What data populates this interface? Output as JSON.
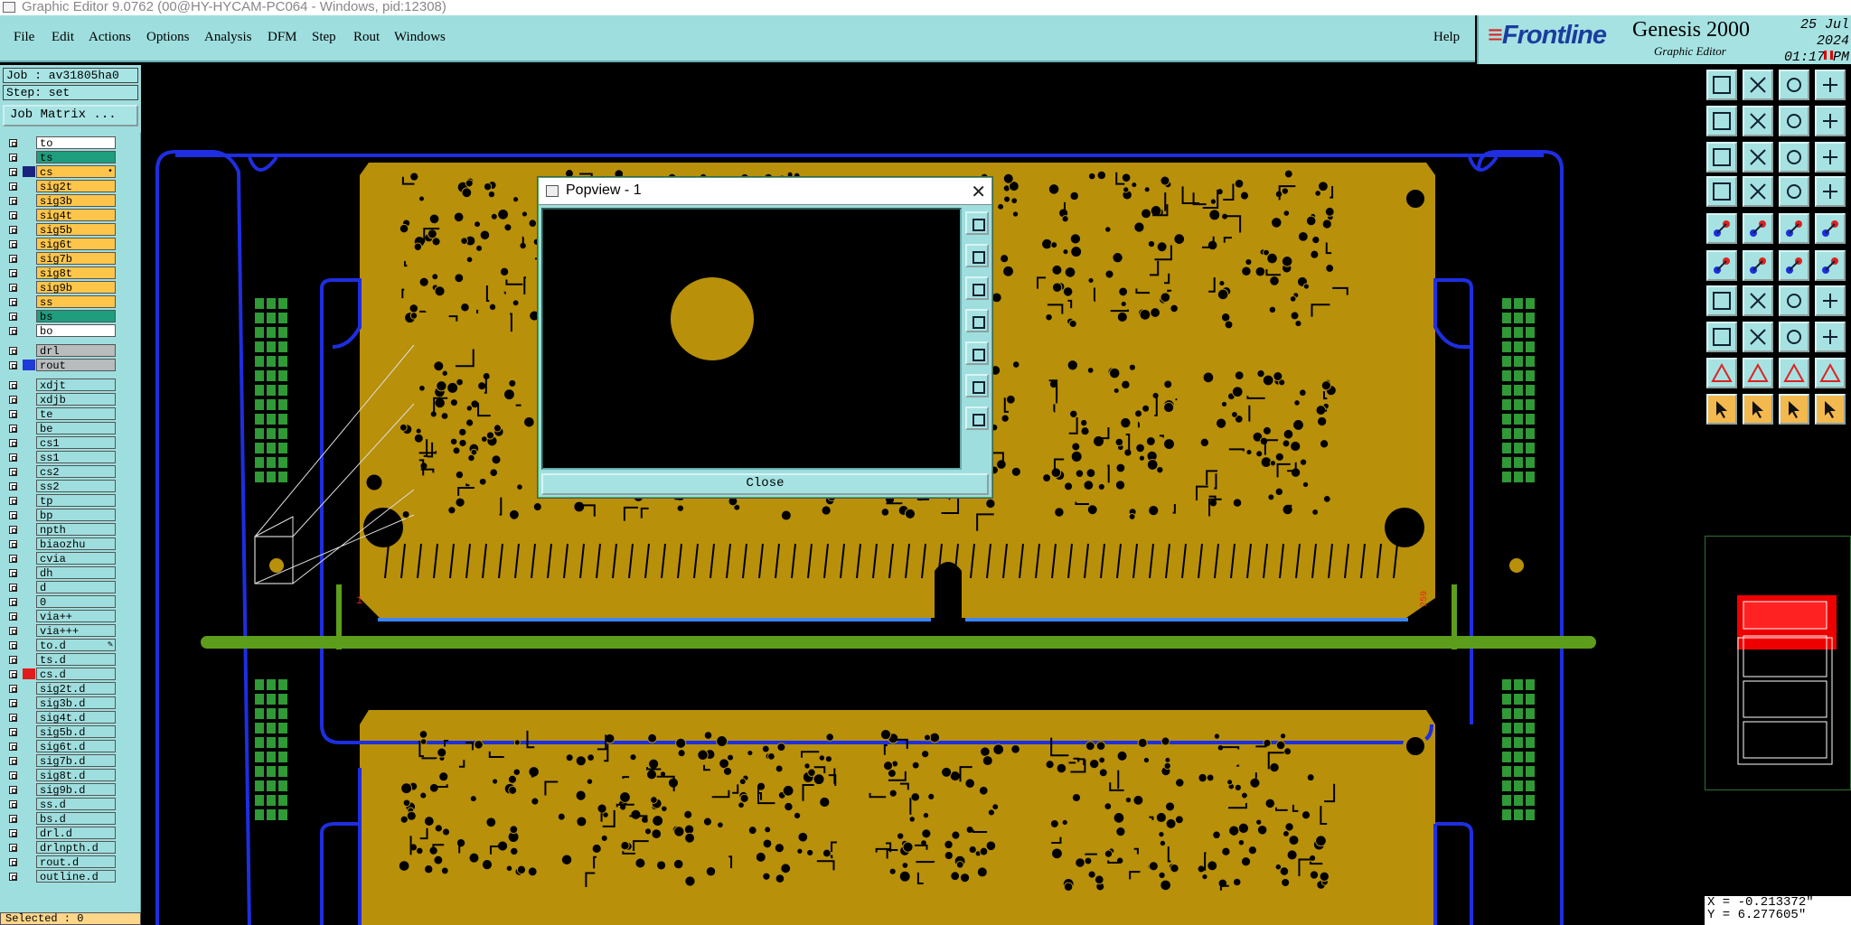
{
  "window": {
    "title": "Graphic Editor 9.0762 (00@HY-HYCAM-PC064 - Windows, pid:12308)"
  },
  "menu": {
    "items": [
      "File",
      "Edit",
      "Actions",
      "Options",
      "Analysis",
      "DFM",
      "Step",
      "Rout",
      "Windows"
    ],
    "help": "Help"
  },
  "brand": {
    "logo": "Frontline",
    "product": "Genesis 2000",
    "subtitle": "Graphic Editor",
    "date": "25 Jul 2024",
    "time": "01:17 PM"
  },
  "job": {
    "job_label": "Job : av31805ha0",
    "step_label": "Step: set",
    "matrix_button": "Job Matrix ..."
  },
  "layers": [
    {
      "name": "to",
      "color": "#ffffff",
      "swatch": ""
    },
    {
      "name": "ts",
      "color": "#1f9e7e",
      "swatch": ""
    },
    {
      "name": "cs",
      "color": "#fdc54a",
      "swatch": "#1a237e",
      "mark": "•"
    },
    {
      "name": "sig2t",
      "color": "#fdc54a",
      "swatch": ""
    },
    {
      "name": "sig3b",
      "color": "#fdc54a",
      "swatch": ""
    },
    {
      "name": "sig4t",
      "color": "#fdc54a",
      "swatch": ""
    },
    {
      "name": "sig5b",
      "color": "#fdc54a",
      "swatch": ""
    },
    {
      "name": "sig6t",
      "color": "#fdc54a",
      "swatch": ""
    },
    {
      "name": "sig7b",
      "color": "#fdc54a",
      "swatch": ""
    },
    {
      "name": "sig8t",
      "color": "#fdc54a",
      "swatch": ""
    },
    {
      "name": "sig9b",
      "color": "#fdc54a",
      "swatch": ""
    },
    {
      "name": "ss",
      "color": "#fdc54a",
      "swatch": ""
    },
    {
      "name": "bs",
      "color": "#1f9e7e",
      "swatch": ""
    },
    {
      "name": "bo",
      "color": "#ffffff",
      "swatch": ""
    },
    {
      "name": "drl",
      "color": "#b8bcbc",
      "swatch": "",
      "gap": true
    },
    {
      "name": "rout",
      "color": "#b8bcbc",
      "swatch": "#1e3ad8"
    },
    {
      "name": "xdjt",
      "color": "#9fdede",
      "swatch": "",
      "gap": true
    },
    {
      "name": "xdjb",
      "color": "#9fdede",
      "swatch": ""
    },
    {
      "name": "te",
      "color": "#9fdede",
      "swatch": ""
    },
    {
      "name": "be",
      "color": "#9fdede",
      "swatch": ""
    },
    {
      "name": "cs1",
      "color": "#9fdede",
      "swatch": ""
    },
    {
      "name": "ss1",
      "color": "#9fdede",
      "swatch": ""
    },
    {
      "name": "cs2",
      "color": "#9fdede",
      "swatch": ""
    },
    {
      "name": "ss2",
      "color": "#9fdede",
      "swatch": ""
    },
    {
      "name": "tp",
      "color": "#9fdede",
      "swatch": ""
    },
    {
      "name": "bp",
      "color": "#9fdede",
      "swatch": ""
    },
    {
      "name": "npth",
      "color": "#9fdede",
      "swatch": ""
    },
    {
      "name": "biaozhu",
      "color": "#9fdede",
      "swatch": ""
    },
    {
      "name": "cvia",
      "color": "#9fdede",
      "swatch": ""
    },
    {
      "name": "dh",
      "color": "#9fdede",
      "swatch": ""
    },
    {
      "name": "d",
      "color": "#9fdede",
      "swatch": ""
    },
    {
      "name": "0",
      "color": "#9fdede",
      "swatch": ""
    },
    {
      "name": "via++",
      "color": "#9fdede",
      "swatch": ""
    },
    {
      "name": "via+++",
      "color": "#9fdede",
      "swatch": ""
    },
    {
      "name": "to.d",
      "color": "#9fdede",
      "swatch": "",
      "mark": "✎"
    },
    {
      "name": "ts.d",
      "color": "#9fdede",
      "swatch": ""
    },
    {
      "name": "cs.d",
      "color": "#9fdede",
      "swatch": "#e21b1b"
    },
    {
      "name": "sig2t.d",
      "color": "#9fdede",
      "swatch": ""
    },
    {
      "name": "sig3b.d",
      "color": "#9fdede",
      "swatch": ""
    },
    {
      "name": "sig4t.d",
      "color": "#9fdede",
      "swatch": ""
    },
    {
      "name": "sig5b.d",
      "color": "#9fdede",
      "swatch": ""
    },
    {
      "name": "sig6t.d",
      "color": "#9fdede",
      "swatch": ""
    },
    {
      "name": "sig7b.d",
      "color": "#9fdede",
      "swatch": ""
    },
    {
      "name": "sig8t.d",
      "color": "#9fdede",
      "swatch": ""
    },
    {
      "name": "sig9b.d",
      "color": "#9fdede",
      "swatch": ""
    },
    {
      "name": "ss.d",
      "color": "#9fdede",
      "swatch": ""
    },
    {
      "name": "bs.d",
      "color": "#9fdede",
      "swatch": ""
    },
    {
      "name": "drl.d",
      "color": "#9fdede",
      "swatch": ""
    },
    {
      "name": "drlnpth.d",
      "color": "#9fdede",
      "swatch": ""
    },
    {
      "name": "rout.d",
      "color": "#9fdede",
      "swatch": ""
    },
    {
      "name": "outline.d",
      "color": "#9fdede",
      "swatch": ""
    }
  ],
  "status": {
    "selected": "Selected : 0"
  },
  "coords": {
    "x": "X = -0.213372\"",
    "y": "Y = 6.277605\""
  },
  "canvas": {
    "board_color": "#b8900a",
    "profile_color": "#1e2ee0",
    "rail_color": "#5c9e1c",
    "label_first": "1",
    "label_last": "259"
  },
  "popview": {
    "title": "Popview - 1",
    "close_label": "Close"
  },
  "toolbox": {
    "icons": [
      "home-up-icon",
      "home-down-icon",
      "home-icon",
      "window-icon",
      "pan-left-icon",
      "pan-right-icon",
      "refresh-icon",
      "layout-icon",
      "zoom-fit-icon",
      "zoom-center-icon",
      "ratio-icon",
      "help-icon",
      "measure-icon",
      "grid-icon",
      "layers-icon",
      "layers-red-icon",
      "pad-icon",
      "route-icon",
      "line-icon",
      "circle-icon",
      "node-icon",
      "cross-icon",
      "connect-icon",
      "split-icon",
      "draw-icon",
      "pen-icon",
      "arc-icon",
      "text-icon",
      "move-icon",
      "resize-icon",
      "align-icon",
      "copy-icon",
      "triangle-icon",
      "triangle-a-icon",
      "triangle-b-icon",
      "triangle-c-icon",
      "select-icon",
      "select-add-icon",
      "select-sub-icon",
      "select-net-icon"
    ]
  }
}
